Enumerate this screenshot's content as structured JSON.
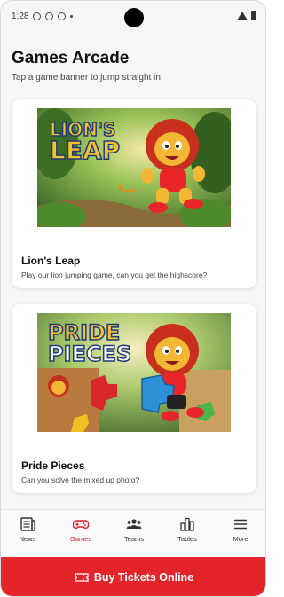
{
  "status_bar": {
    "time": "1:28"
  },
  "header": {
    "title": "Games Arcade",
    "subtitle": "Tap a game banner to jump straight in."
  },
  "games": [
    {
      "title": "Lion's Leap",
      "description": "Play our lion jumping game, can you get the highscore?",
      "banner_text": [
        "LION'S",
        "LEAP"
      ]
    },
    {
      "title": "Pride Pieces",
      "description": "Can you solve the mixed up photo?",
      "banner_text": [
        "PRIDE",
        "PIECES"
      ]
    }
  ],
  "bottom_nav": {
    "items": [
      {
        "label": "News",
        "icon": "newspaper-icon"
      },
      {
        "label": "Games",
        "icon": "gamepad-icon",
        "active": true
      },
      {
        "label": "Teams",
        "icon": "people-icon"
      },
      {
        "label": "Tables",
        "icon": "bar-chart-icon"
      },
      {
        "label": "More",
        "icon": "menu-icon"
      }
    ]
  },
  "cta": {
    "label": "Buy Tickets Online",
    "icon": "ticket-icon"
  },
  "colors": {
    "accent": "#e3242b",
    "active_nav": "#d3202a"
  }
}
